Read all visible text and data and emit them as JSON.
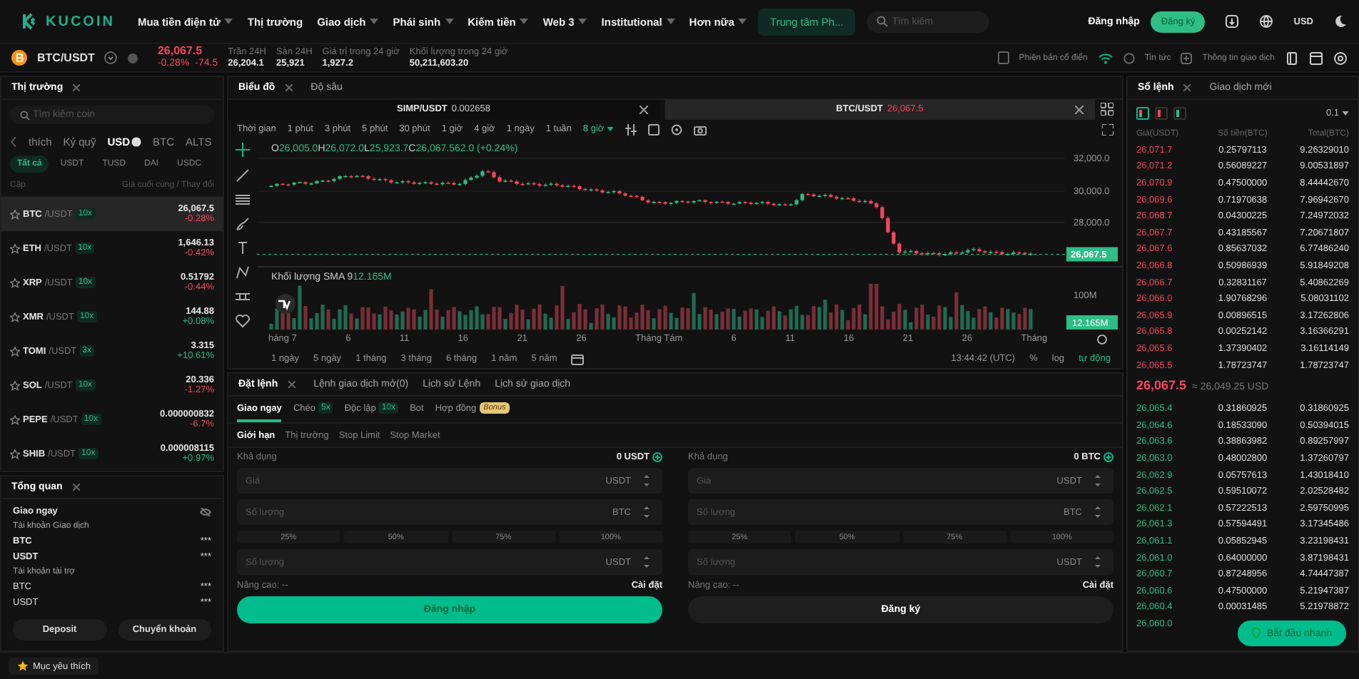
{
  "nav": {
    "logo": "KUCOIN",
    "menu": [
      {
        "label": "Mua tiền điện tử",
        "dropdown": true
      },
      {
        "label": "Thị trường",
        "dropdown": false
      },
      {
        "label": "Giao dịch",
        "dropdown": true
      },
      {
        "label": "Phái sinh",
        "dropdown": true
      },
      {
        "label": "Kiếm tiền",
        "dropdown": true
      },
      {
        "label": "Web 3",
        "dropdown": true
      },
      {
        "label": "Institutional",
        "dropdown": true
      },
      {
        "label": "Hơn nữa",
        "dropdown": true
      }
    ],
    "highlight": "Trung tâm Ph...",
    "search_placeholder": "Tìm kiếm",
    "login": "Đăng nhập",
    "signup": "Đăng ký",
    "currency": "USD"
  },
  "ticker": {
    "pair": "BTC/USDT",
    "price": "26,067.5",
    "change_pct": "-0.28%",
    "change_abs": "-74.5",
    "stats": [
      {
        "label": "Trần 24H",
        "value": "26,204.1"
      },
      {
        "label": "Sàn 24H",
        "value": "25,921"
      },
      {
        "label": "Giá trị trong 24 giờ",
        "value": "1,927.2"
      },
      {
        "label": "Khối lượng trong 24 giờ",
        "value": "50,211,603.20"
      }
    ],
    "classic": "Phiên bản cổ điển",
    "news": "Tin tức",
    "info": "Thông tin giao dịch"
  },
  "market": {
    "title": "Thị trường",
    "search_placeholder": "Tìm kiếm coin",
    "categories": [
      {
        "label": "thích",
        "selected": false
      },
      {
        "label": "Ký quỹ",
        "selected": false
      },
      {
        "label": "USD",
        "selected": true
      },
      {
        "label": "BTC",
        "selected": false
      },
      {
        "label": "ALTS",
        "selected": false
      }
    ],
    "subtabs": [
      {
        "label": "Tất cả",
        "selected": true
      },
      {
        "label": "USDT",
        "selected": false
      },
      {
        "label": "TUSD",
        "selected": false
      },
      {
        "label": "DAI",
        "selected": false
      },
      {
        "label": "USDC",
        "selected": false
      }
    ],
    "columns": [
      "Cặp",
      "Giá cuối cùng / Thay đổi"
    ],
    "rows": [
      {
        "base": "BTC",
        "quote": "/USDT",
        "leverage": "10x",
        "price": "26,067.5",
        "change": "-0.28%",
        "color": "#f6465d",
        "selected": true
      },
      {
        "base": "ETH",
        "quote": "/USDT",
        "leverage": "10x",
        "price": "1,646.13",
        "change": "-0.42%",
        "color": "#f6465d",
        "selected": false
      },
      {
        "base": "XRP",
        "quote": "/USDT",
        "leverage": "10x",
        "price": "0.51792",
        "change": "-0.44%",
        "color": "#f6465d",
        "selected": false
      },
      {
        "base": "XMR",
        "quote": "/USDT",
        "leverage": "10x",
        "price": "144.88",
        "change": "+0.08%",
        "color": "#2ebd85",
        "selected": false
      },
      {
        "base": "TOMI",
        "quote": "/USDT",
        "leverage": "3x",
        "price": "3.315",
        "change": "+10.61%",
        "color": "#2ebd85",
        "selected": false
      },
      {
        "base": "SOL",
        "quote": "/USDT",
        "leverage": "10x",
        "price": "20.336",
        "change": "-1.27%",
        "color": "#f6465d",
        "selected": false
      },
      {
        "base": "PEPE",
        "quote": "/USDT",
        "leverage": "10x",
        "price": "0.000000832",
        "change": "-6.7%",
        "color": "#f6465d",
        "selected": false
      },
      {
        "base": "SHIB",
        "quote": "/USDT",
        "leverage": "10x",
        "price": "0.000008115",
        "change": "+0.97%",
        "color": "#2ebd85",
        "selected": false
      }
    ]
  },
  "overview": {
    "title": "Tổng quan",
    "mode": "Giao ngay",
    "sections": [
      {
        "title": "Tài khoản Giao dịch",
        "items": [
          {
            "asset": "BTC",
            "value": "***"
          },
          {
            "asset": "USDT",
            "value": "***"
          }
        ]
      },
      {
        "title": "Tài khoản tài trợ",
        "items": [
          {
            "asset": "BTC",
            "value": "***"
          },
          {
            "asset": "USDT",
            "value": "***"
          }
        ]
      }
    ],
    "buttons": [
      "Deposit",
      "Chuyển khoản"
    ]
  },
  "favorites": "Mục yêu thích",
  "chart": {
    "tabs": [
      {
        "label": "Biểu đồ",
        "selected": true
      },
      {
        "label": "Độ sâu",
        "selected": false
      }
    ],
    "pairs": [
      {
        "pair": "SIMP/USDT",
        "price": "0.002658",
        "color": "#cccccc",
        "selected": false
      },
      {
        "pair": "BTC/USDT",
        "price": "26,067.5",
        "color": "#f6465d",
        "selected": true
      }
    ],
    "intervals": [
      {
        "label": "Thời gian",
        "selected": false
      },
      {
        "label": "1 phút",
        "selected": false
      },
      {
        "label": "3 phút",
        "selected": false
      },
      {
        "label": "5 phút",
        "selected": false
      },
      {
        "label": "30 phút",
        "selected": false
      },
      {
        "label": "1 giờ",
        "selected": false
      },
      {
        "label": "4 giờ",
        "selected": false
      },
      {
        "label": "1 ngày",
        "selected": false
      },
      {
        "label": "1 tuần",
        "selected": false
      },
      {
        "label": "8 giờ",
        "selected": true
      }
    ],
    "ohlc": [
      {
        "key": "O",
        "value": "26,005.0"
      },
      {
        "key": "H",
        "value": "26,072.0"
      },
      {
        "key": "L",
        "value": "25,923.7"
      },
      {
        "key": "C",
        "value": "26,067.5"
      }
    ],
    "ohlc_change": "62.0 (+0.24%)",
    "yticks": [
      "32,000.0",
      "30,000.0",
      "28,000.0"
    ],
    "last_price": "26,067.5",
    "volume_label": "Khối lượng SMA 9",
    "volume_value": "12.165M",
    "volume_tick": "100M",
    "volume_tag": "12.165M",
    "xlabels": [
      "háng 7",
      "6",
      "11",
      "16",
      "21",
      "26",
      "Tháng Tám",
      "6",
      "11",
      "16",
      "21",
      "26",
      "Tháng"
    ],
    "ranges": [
      "1 ngày",
      "5 ngày",
      "1 tháng",
      "3 tháng",
      "6 tháng",
      "1 năm",
      "5 năm"
    ],
    "time": "13:44:42 (UTC)",
    "scales": [
      {
        "label": "%",
        "selected": false
      },
      {
        "label": "log",
        "selected": false
      },
      {
        "label": "tự động",
        "selected": true
      }
    ]
  },
  "order": {
    "tabs": [
      {
        "label": "Đặt lệnh",
        "selected": true
      },
      {
        "label": "Lệnh giao dịch mở(0)",
        "selected": false
      },
      {
        "label": "Lịch sử Lệnh",
        "selected": false
      },
      {
        "label": "Lịch sử giao dịch",
        "selected": false
      }
    ],
    "modes": [
      {
        "label": "Giao ngay",
        "selected": true
      },
      {
        "label": "Chéo",
        "badge": "5x",
        "selected": false
      },
      {
        "label": "Độc lập",
        "badge": "10x",
        "selected": false
      },
      {
        "label": "Bot",
        "selected": false
      },
      {
        "label": "Hợp đồng",
        "promo": "Bonus",
        "selected": false
      }
    ],
    "types": [
      {
        "label": "Giới hạn",
        "selected": true
      },
      {
        "label": "Thị trường",
        "selected": false
      },
      {
        "label": "Stop Limit",
        "selected": false
      },
      {
        "label": "Stop Market",
        "selected": false
      }
    ],
    "sides": [
      {
        "kind": "buy",
        "available_label": "Khả dụng",
        "available": "0 USDT",
        "price_placeholder": "Giá",
        "price_unit": "USDT",
        "amount_placeholder": "Số lượng",
        "amount_unit": "BTC",
        "percents": [
          "25%",
          "50%",
          "75%",
          "100%"
        ],
        "total_placeholder": "Số lượng",
        "total_unit": "USDT",
        "advanced": "Nâng cao: --",
        "settings": "Cài đặt",
        "action": "Đăng nhập"
      },
      {
        "kind": "sell",
        "available_label": "Khả dụng",
        "available": "0 BTC",
        "price_placeholder": "Giá",
        "price_unit": "USDT",
        "amount_placeholder": "Số lượng",
        "amount_unit": "BTC",
        "percents": [
          "25%",
          "50%",
          "75%",
          "100%"
        ],
        "total_placeholder": "Số lượng",
        "total_unit": "USDT",
        "advanced": "Nâng cao: --",
        "settings": "Cài đặt",
        "action": "Đăng ký"
      }
    ]
  },
  "book": {
    "tabs": [
      {
        "label": "Sổ lệnh",
        "selected": true
      },
      {
        "label": "Giao dịch mới",
        "selected": false
      }
    ],
    "views": [
      {
        "kind": "both",
        "selected": true
      },
      {
        "kind": "asks",
        "selected": false
      },
      {
        "kind": "bids",
        "selected": false
      }
    ],
    "precision": "0.1",
    "columns": [
      "Giá(USDT)",
      "Số tiền(BTC)",
      "Total(BTC)"
    ],
    "asks": [
      {
        "price": "26,071.7",
        "amount": "0.25797113",
        "total": "9.26329010"
      },
      {
        "price": "26,071.2",
        "amount": "0.56089227",
        "total": "9.00531897"
      },
      {
        "price": "26,070.9",
        "amount": "0.47500000",
        "total": "8.44442670"
      },
      {
        "price": "26,069.6",
        "amount": "0.71970638",
        "total": "7.96942670"
      },
      {
        "price": "26,068.7",
        "amount": "0.04300225",
        "total": "7.24972032"
      },
      {
        "price": "26,067.7",
        "amount": "0.43185567",
        "total": "7.20671807"
      },
      {
        "price": "26,067.6",
        "amount": "0.85637032",
        "total": "6.77486240"
      },
      {
        "price": "26,066.8",
        "amount": "0.50986939",
        "total": "5.91849208"
      },
      {
        "price": "26,066.7",
        "amount": "0.32831167",
        "total": "5.40862269"
      },
      {
        "price": "26,066.0",
        "amount": "1.90768296",
        "total": "5.08031102"
      },
      {
        "price": "26,065.9",
        "amount": "0.00896515",
        "total": "3.17262806"
      },
      {
        "price": "26,065.8",
        "amount": "0.00252142",
        "total": "3.16366291"
      },
      {
        "price": "26,065.6",
        "amount": "1.37390402",
        "total": "3.16114149"
      },
      {
        "price": "26,065.5",
        "amount": "1.78723747",
        "total": "1.78723747"
      }
    ],
    "mid_price": "26,067.5",
    "mid_usd": "≈ 26,049.25 USD",
    "bids": [
      {
        "price": "26,065.4",
        "amount": "0.31860925",
        "total": "0.31860925"
      },
      {
        "price": "26,064.6",
        "amount": "0.18533090",
        "total": "0.50394015"
      },
      {
        "price": "26,063.6",
        "amount": "0.38863982",
        "total": "0.89257997"
      },
      {
        "price": "26,063.0",
        "amount": "0.48002800",
        "total": "1.37260797"
      },
      {
        "price": "26,062.9",
        "amount": "0.05757613",
        "total": "1.43018410"
      },
      {
        "price": "26,062.5",
        "amount": "0.59510072",
        "total": "2.02528482"
      },
      {
        "price": "26,062.1",
        "amount": "0.57222513",
        "total": "2.59750995"
      },
      {
        "price": "26,061.3",
        "amount": "0.57594491",
        "total": "3.17345486"
      },
      {
        "price": "26,061.1",
        "amount": "0.05852945",
        "total": "3.23198431"
      },
      {
        "price": "26,061.0",
        "amount": "0.64000000",
        "total": "3.87198431"
      },
      {
        "price": "26,060.7",
        "amount": "0.87248956",
        "total": "4.74447387"
      },
      {
        "price": "26,060.6",
        "amount": "0.47500000",
        "total": "5.21947387"
      },
      {
        "price": "26,060.4",
        "amount": "0.00031485",
        "total": "5.21978872"
      },
      {
        "price": "26,060.0"
      }
    ],
    "quick_start": "Bắt đầu nhanh"
  }
}
